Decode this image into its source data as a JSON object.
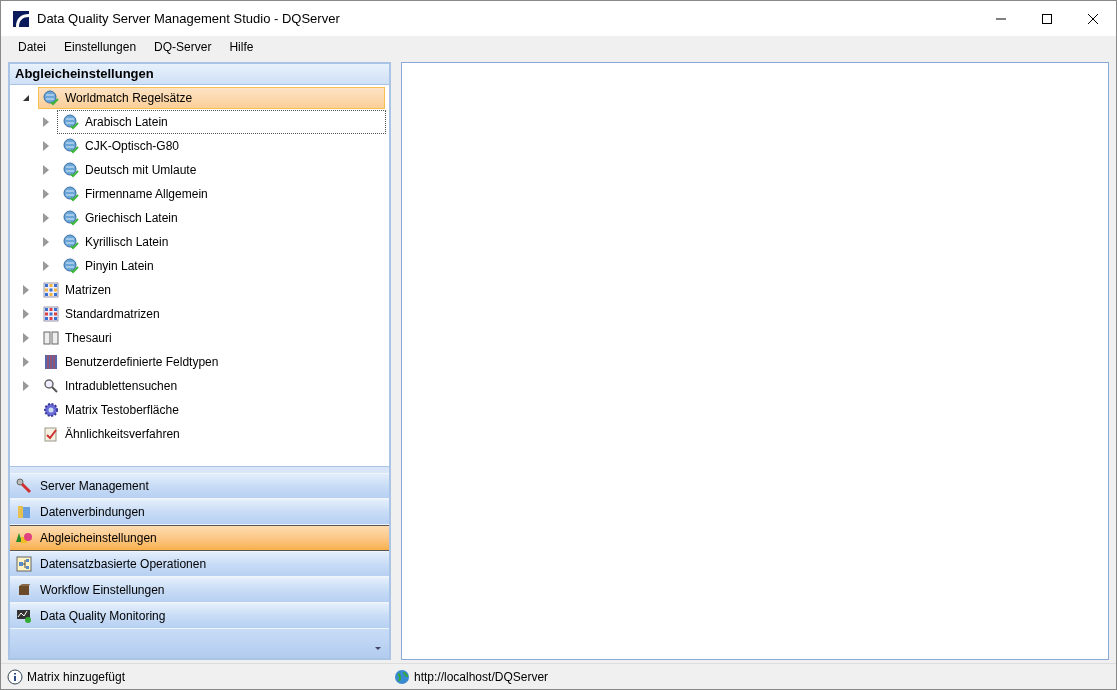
{
  "window": {
    "title": "Data Quality Server Management Studio - DQServer"
  },
  "menu": [
    "Datei",
    "Einstellungen",
    "DQ-Server",
    "Hilfe"
  ],
  "panel": {
    "title": "Abgleicheinstellungen",
    "tree": [
      {
        "label": "Worldmatch Regelsätze",
        "kind": "globe",
        "expanded": true,
        "selected": true,
        "focused": false,
        "children": [
          {
            "label": "Arabisch Latein",
            "kind": "globe",
            "expanded": false,
            "selected": false,
            "focused": true
          },
          {
            "label": "CJK-Optisch-G80",
            "kind": "globe",
            "expanded": false,
            "selected": false,
            "focused": false
          },
          {
            "label": "Deutsch mit Umlaute",
            "kind": "globe",
            "expanded": false,
            "selected": false,
            "focused": false
          },
          {
            "label": "Firmenname Allgemein",
            "kind": "globe",
            "expanded": false,
            "selected": false,
            "focused": false
          },
          {
            "label": "Griechisch Latein",
            "kind": "globe",
            "expanded": false,
            "selected": false,
            "focused": false
          },
          {
            "label": "Kyrillisch Latein",
            "kind": "globe",
            "expanded": false,
            "selected": false,
            "focused": false
          },
          {
            "label": "Pinyin Latein",
            "kind": "globe",
            "expanded": false,
            "selected": false,
            "focused": false
          }
        ]
      },
      {
        "label": "Matrizen",
        "kind": "matrix",
        "expanded": false,
        "selected": false,
        "focused": false
      },
      {
        "label": "Standardmatrizen",
        "kind": "matrix-red",
        "expanded": false,
        "selected": false,
        "focused": false
      },
      {
        "label": "Thesauri",
        "kind": "book",
        "expanded": false,
        "selected": false,
        "focused": false
      },
      {
        "label": "Benutzerdefinierte Feldtypen",
        "kind": "columns",
        "expanded": false,
        "selected": false,
        "focused": false
      },
      {
        "label": "Intradublettensuchen",
        "kind": "search",
        "expanded": false,
        "selected": false,
        "focused": false
      },
      {
        "label": "Matrix Testoberfläche",
        "kind": "gear",
        "selected": false,
        "focused": false
      },
      {
        "label": "Ähnlichkeitsverfahren",
        "kind": "checklist",
        "selected": false,
        "focused": false
      }
    ]
  },
  "nav": [
    {
      "label": "Server Management",
      "kind": "wrench",
      "selected": false
    },
    {
      "label": "Datenverbindungen",
      "kind": "cylinder",
      "selected": false
    },
    {
      "label": "Abgleicheinstellungen",
      "kind": "shapes",
      "selected": true
    },
    {
      "label": "Datensatzbasierte Operationen",
      "kind": "diagram",
      "selected": false
    },
    {
      "label": "Workflow Einstellungen",
      "kind": "box",
      "selected": false
    },
    {
      "label": "Data Quality Monitoring",
      "kind": "monitor",
      "selected": false
    }
  ],
  "status_bar": {
    "message": "Matrix hinzugefügt",
    "url": "http://localhost/DQServer"
  }
}
